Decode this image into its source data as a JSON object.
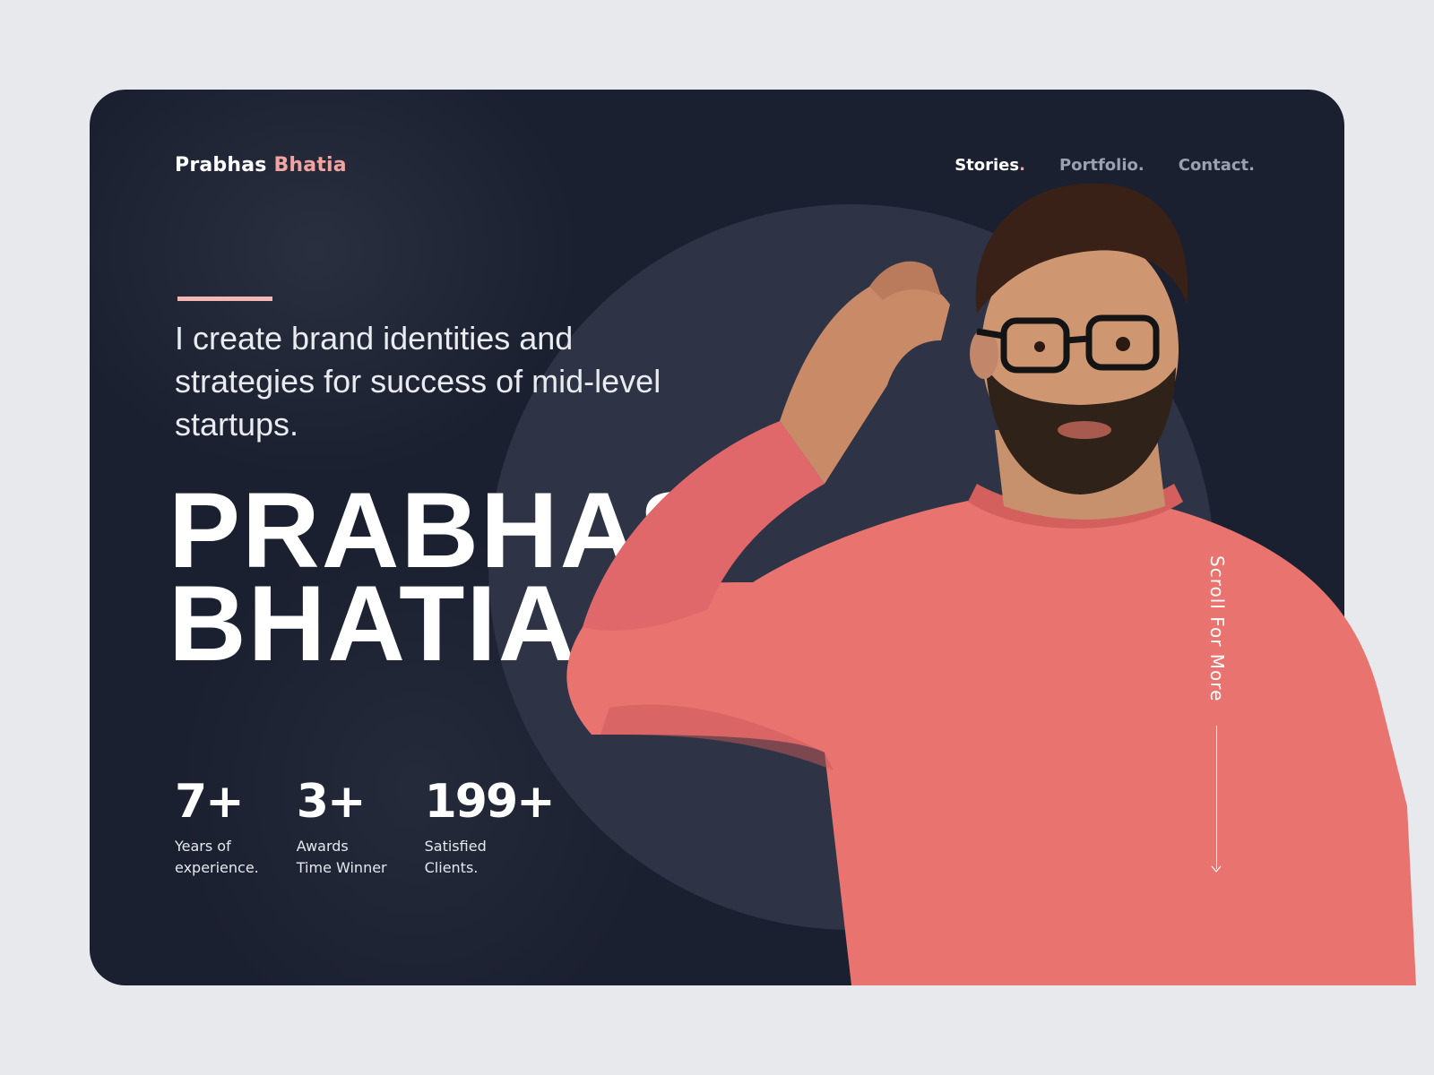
{
  "brand": {
    "first": "Prabhas",
    "last": "Bhatia"
  },
  "nav": [
    {
      "label": "Stories",
      "dot": ".",
      "active": true
    },
    {
      "label": "Portfolio",
      "dot": ".",
      "active": false
    },
    {
      "label": "Contact",
      "dot": ".",
      "active": false
    }
  ],
  "hero": {
    "tagline": "I create brand identities and strategies for success of mid-level startups.",
    "name_line1": "PRABHAS",
    "name_line2": "BHATIA"
  },
  "stats": [
    {
      "value": "7+",
      "label": "Years of\nexperience."
    },
    {
      "value": "3+",
      "label": "Awards\nTime Winner"
    },
    {
      "value": "199+",
      "label": "Satisfied\nClients."
    }
  ],
  "scroll": {
    "label": "Scroll For More"
  },
  "colors": {
    "page_bg": "#e8e9ed",
    "card_bg": "#1b2030",
    "circle": "#2e3445",
    "accent": "#f3a3a0",
    "sweater": "#e8736f"
  },
  "icons": [
    "arrow-down-icon"
  ]
}
